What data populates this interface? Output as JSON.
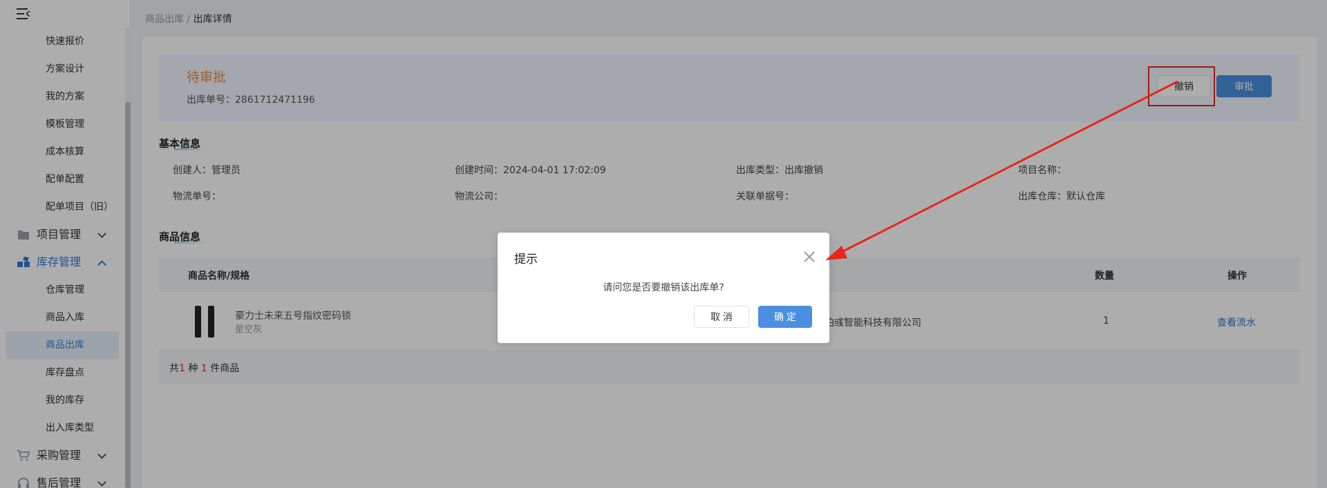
{
  "sidebar": {
    "items": [
      {
        "label": "快速报价"
      },
      {
        "label": "方案设计"
      },
      {
        "label": "我的方案"
      },
      {
        "label": "模板管理"
      },
      {
        "label": "成本核算"
      },
      {
        "label": "配单配置"
      },
      {
        "label": "配单项目（旧）"
      }
    ],
    "groups": {
      "project": "项目管理",
      "inventory": "库存管理",
      "purchase": "采购管理",
      "aftersale": "售后管理"
    },
    "inventory_items": [
      {
        "label": "仓库管理"
      },
      {
        "label": "商品入库"
      },
      {
        "label": "商品出库"
      },
      {
        "label": "库存盘点"
      },
      {
        "label": "我的库存"
      },
      {
        "label": "出入库类型"
      }
    ]
  },
  "breadcrumb": {
    "parent": "商品出库",
    "separator": "/",
    "current": "出库详情"
  },
  "status": {
    "title": "待审批",
    "order_label": "出库单号：",
    "order_no": "2861712471196"
  },
  "actions": {
    "revoke": "撤销",
    "approve": "审批"
  },
  "basic_info": {
    "title": "基本信息",
    "creator": "创建人：管理员",
    "created_at": "创建时间：2024-04-01 17:02:09",
    "out_type": "出库类型：出库撤销",
    "project_name": "项目名称：",
    "logistics_no": "物流单号：",
    "logistics_company": "物流公司：",
    "related_no": "关联单据号：",
    "warehouse": "出库仓库：默认仓库"
  },
  "goods": {
    "title": "商品信息",
    "columns": {
      "name": "商品名称/规格",
      "qty": "数量",
      "ops": "操作"
    },
    "rows": [
      {
        "name": "豪力士未来五号指纹密码锁",
        "spec": "星空灰",
        "supplier": "上海珀彧智能科技有限公司",
        "qty": "1",
        "action": "查看流水"
      }
    ],
    "footer": {
      "prefix": "共",
      "kinds": "1",
      "mid": " 种 ",
      "count": "1",
      "suffix": " 件商品"
    }
  },
  "dialog": {
    "title": "提示",
    "message": "请问您是否要撤销该出库单?",
    "cancel": "取 消",
    "confirm": "确 定"
  },
  "colors": {
    "accent": "#4a8fe0",
    "pending": "#f0883e",
    "annotation": "#e8261e"
  }
}
